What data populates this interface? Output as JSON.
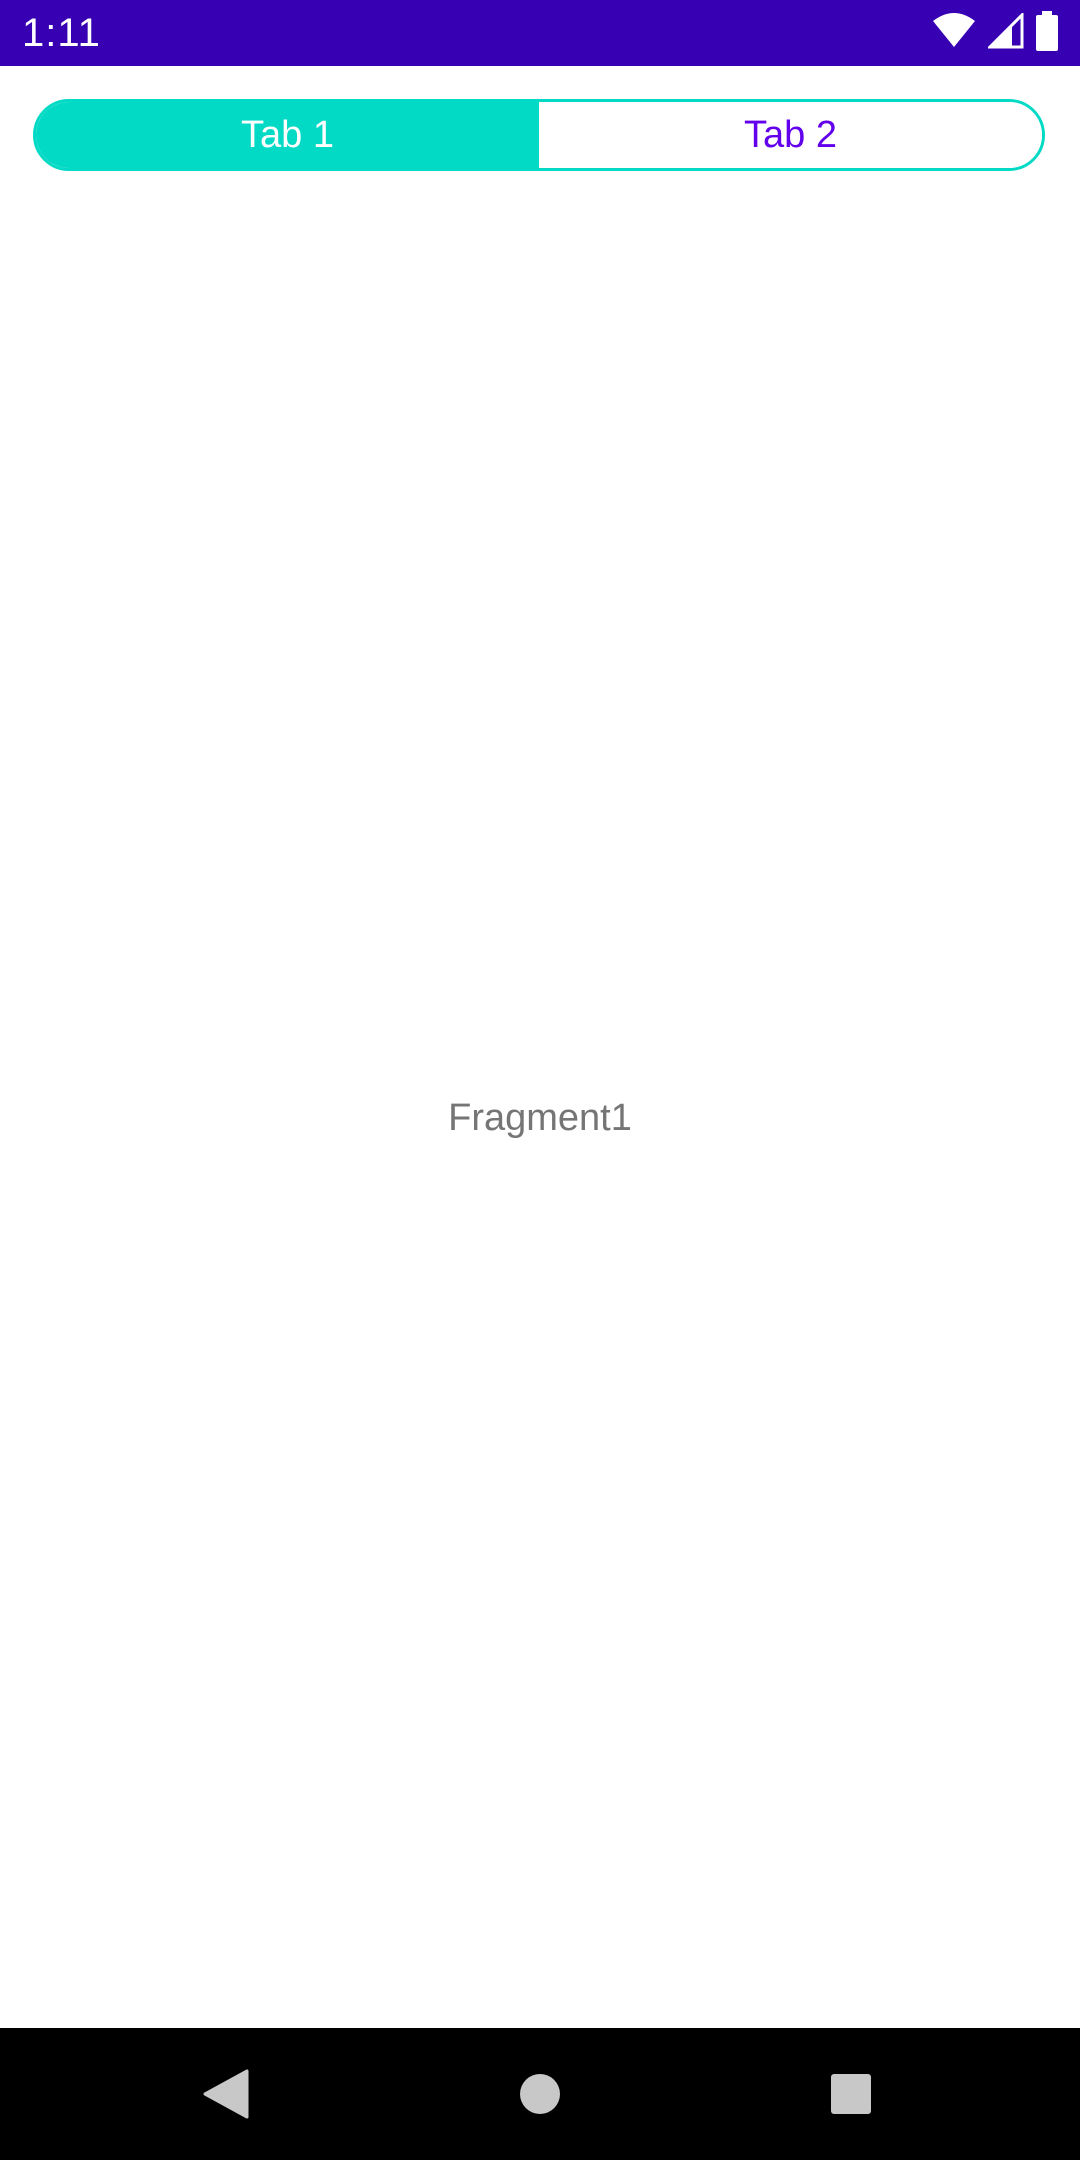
{
  "status_bar": {
    "time": "1:11",
    "background_color": "#3700B3",
    "icons": [
      "wifi-icon",
      "cellular-signal-icon",
      "battery-icon"
    ]
  },
  "tabs": [
    {
      "label": "Tab 1",
      "selected": true
    },
    {
      "label": "Tab 2",
      "selected": false
    }
  ],
  "tab_colors": {
    "selected_background": "#03DAC5",
    "selected_text": "#FFFFFF",
    "unselected_text": "#6200EE",
    "border": "#03DAC5"
  },
  "content": {
    "fragment_text": "Fragment1"
  },
  "navigation_bar": {
    "buttons": [
      "back-icon",
      "home-icon",
      "recents-icon"
    ]
  }
}
